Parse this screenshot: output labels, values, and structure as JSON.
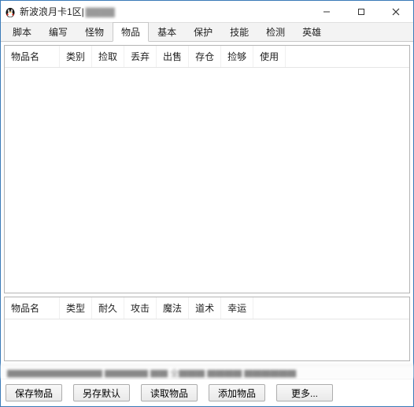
{
  "window": {
    "title": "新波浪月卡1区|",
    "title_blur": "▇▇▇▇",
    "icon": "penguin-icon"
  },
  "tabs": [
    {
      "label": "脚本"
    },
    {
      "label": "编写"
    },
    {
      "label": "怪物"
    },
    {
      "label": "物品",
      "active": true
    },
    {
      "label": "基本"
    },
    {
      "label": "保护"
    },
    {
      "label": "技能"
    },
    {
      "label": "检测"
    },
    {
      "label": "英雄"
    }
  ],
  "grid_top": {
    "columns": [
      "物品名",
      "类别",
      "捡取",
      "丢弃",
      "出售",
      "存仓",
      "捡够",
      "使用"
    ],
    "rows": []
  },
  "grid_bottom": {
    "columns": [
      "物品名",
      "类型",
      "耐久",
      "攻击",
      "魔法",
      "道术",
      "幸运"
    ],
    "rows": []
  },
  "status_text": "▇▇▇▇▇▇▇▇▇▇▇  ▇▇▇▇▇  ▇▇  全▇▇▇  ▇▇▇▇  ▇▇▇▇▇▇",
  "buttons": {
    "save": "保存物品",
    "save_default": "另存默认",
    "load": "读取物品",
    "add": "添加物品",
    "more": "更多..."
  }
}
